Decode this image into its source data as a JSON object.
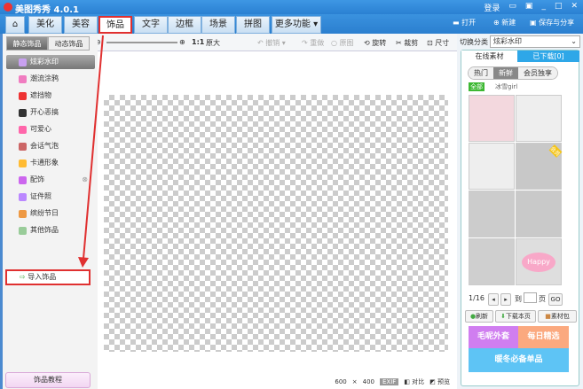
{
  "app": {
    "title": "美图秀秀 4.0.1",
    "login": "登录"
  },
  "menu": {
    "tabs": [
      "美化",
      "美容",
      "饰品",
      "文字",
      "边框",
      "场景",
      "拼图",
      "更多功能 ▾"
    ],
    "active": "饰品",
    "open": "打开",
    "new": "新建",
    "save": "保存与分享"
  },
  "toolbar": {
    "zoom_ratio": "1:1",
    "original": "原大",
    "undo": "撤销",
    "redo": "重做",
    "reset": "原图",
    "rotate": "旋转",
    "crop": "裁剪",
    "size": "尺寸"
  },
  "left": {
    "subtabs": [
      "静态饰品",
      "动态饰品"
    ],
    "categories": [
      "炫彩水印",
      "潮流涂鸦",
      "遮挡物",
      "开心恶搞",
      "可爱心",
      "会话气泡",
      "卡通形象",
      "配饰",
      "证件照",
      "缤纷节日",
      "其他饰品"
    ],
    "selected": "炫彩水印",
    "import": "导入饰品",
    "tutorial": "饰品教程"
  },
  "status": {
    "size_w": "600",
    "size_x": "×",
    "size_h": "400",
    "exif": "EXIF",
    "compare": "对比",
    "preview": "预览"
  },
  "right": {
    "switch_label": "切换分类",
    "category": "炫彩水印",
    "tabs": [
      "在线素材",
      "已下载[0]"
    ],
    "filters": [
      "热门",
      "新鲜",
      "会员独享"
    ],
    "active_filter": "新鲜",
    "all": "全部",
    "author": "冰雪girl",
    "page": "1/16",
    "goto": "到",
    "page_unit": "页",
    "go": "GO",
    "refresh": "刷新",
    "download": "下载本页",
    "pack": "素材包",
    "promos": [
      "毛呢外套",
      "每日精选",
      "暖冬必备单品"
    ],
    "badge": "会员",
    "happy": "Happy"
  },
  "colors": {
    "accent": "#2f86d6",
    "highlight": "#e03030",
    "promo1": "#d07ef0",
    "promo2": "#fba97f",
    "promo3": "#5ec4f5"
  }
}
